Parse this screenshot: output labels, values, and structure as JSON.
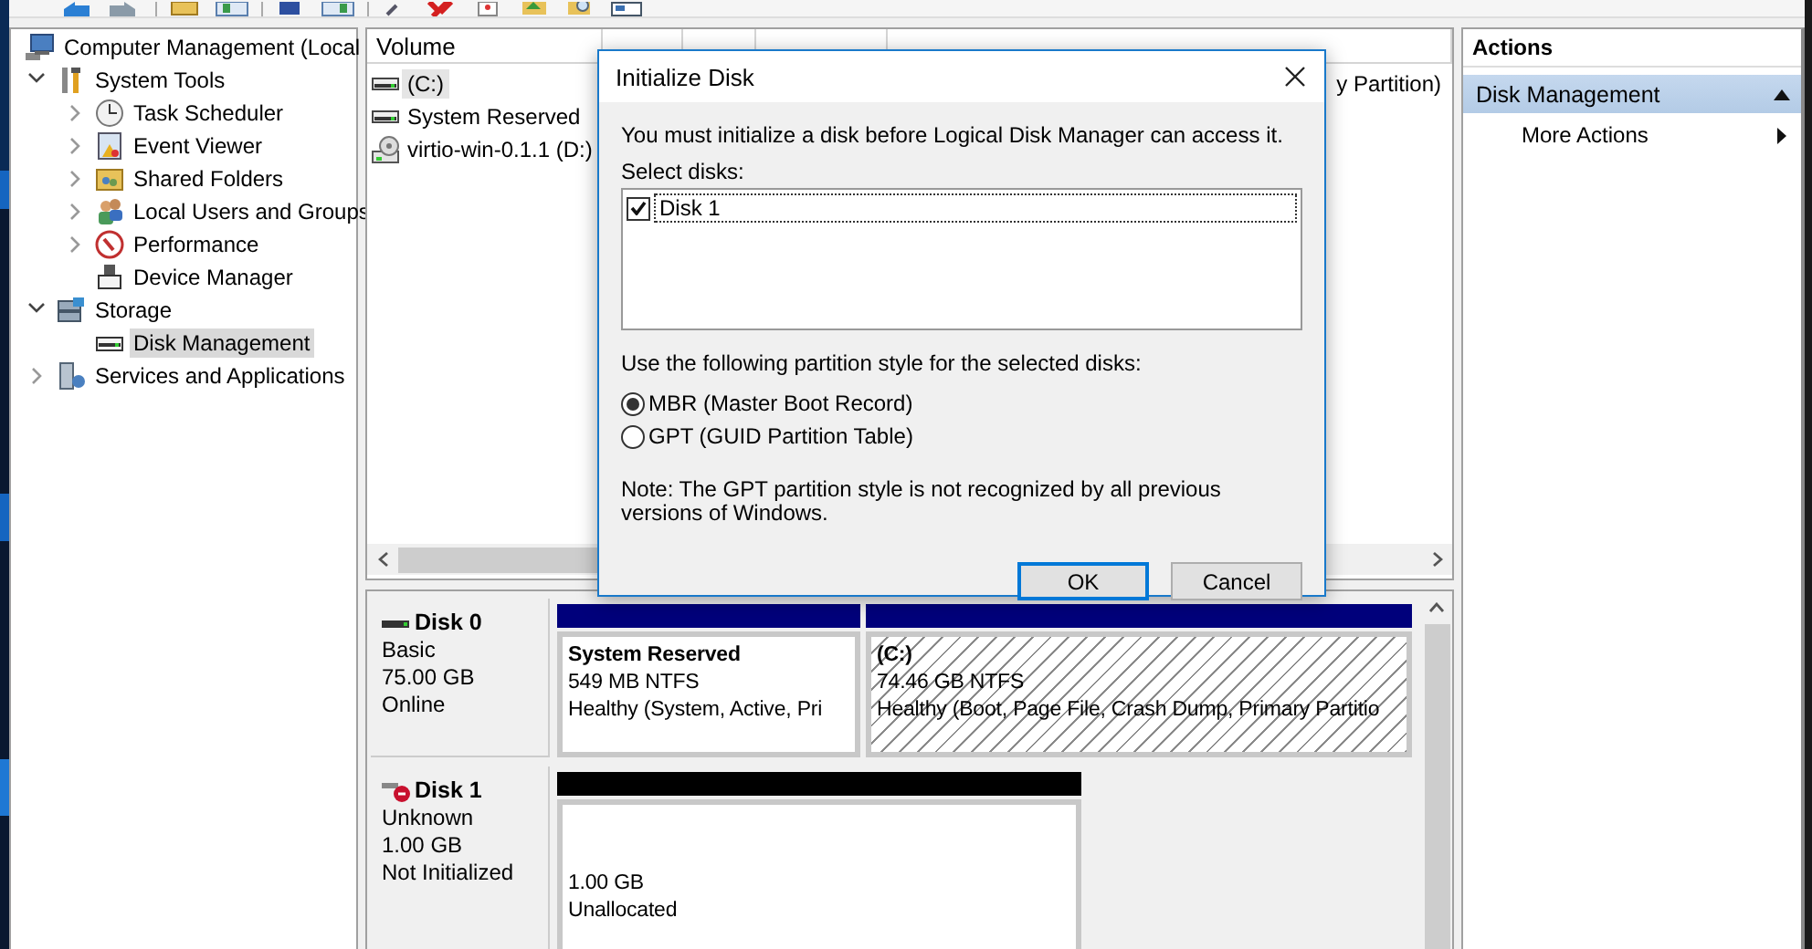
{
  "tree": {
    "items": [
      {
        "label": "Computer Management (Local",
        "selected": false,
        "children": [
          {
            "label": "System Tools",
            "expanded": true,
            "selected": false,
            "children": [
              {
                "label": "Task Scheduler",
                "expanded": false,
                "selected": false
              },
              {
                "label": "Event Viewer",
                "expanded": false,
                "selected": false
              },
              {
                "label": "Shared Folders",
                "expanded": false,
                "selected": false
              },
              {
                "label": "Local Users and Groups",
                "expanded": false,
                "selected": false
              },
              {
                "label": "Performance",
                "expanded": false,
                "selected": false
              },
              {
                "label": "Device Manager",
                "selected": false
              }
            ]
          },
          {
            "label": "Storage",
            "expanded": true,
            "selected": false,
            "children": [
              {
                "label": "Disk Management",
                "selected": true
              }
            ]
          },
          {
            "label": "Services and Applications",
            "expanded": false,
            "selected": false
          }
        ]
      }
    ]
  },
  "volume_list": {
    "columns": [
      "Volume"
    ],
    "rows": [
      {
        "volume": "(C:)",
        "kind": "drive",
        "status": "y Partition)",
        "selected": true
      },
      {
        "volume": "System Reserved",
        "kind": "drive",
        "selected": false
      },
      {
        "volume": "virtio-win-0.1.1 (D:)",
        "kind": "cd",
        "selected": false
      }
    ]
  },
  "disks": [
    {
      "name": "Disk 0",
      "kind": "online",
      "type": "Basic",
      "size": "75.00 GB",
      "state": "Online",
      "partitions": [
        {
          "name": "System Reserved",
          "size": "549 MB NTFS",
          "status": "Healthy (System, Active, Pri",
          "kind": "primary",
          "selected": false
        },
        {
          "name": "(C:)",
          "size": "74.46 GB NTFS",
          "status": "Healthy (Boot, Page File, Crash Dump, Primary Partitio",
          "kind": "primary",
          "selected": true
        }
      ]
    },
    {
      "name": "Disk 1",
      "kind": "error",
      "type": "Unknown",
      "size": "1.00 GB",
      "state": "Not Initialized",
      "partitions": [
        {
          "size": "1.00 GB",
          "status": "Unallocated",
          "kind": "unallocated",
          "selected": false
        }
      ]
    }
  ],
  "actions": {
    "title": "Actions",
    "sections": [
      {
        "label": "Disk Management",
        "expanded": true,
        "items": [
          {
            "label": "More Actions"
          }
        ]
      }
    ]
  },
  "dialog": {
    "title": "Initialize Disk",
    "message": "You must initialize a disk before Logical Disk Manager can access it.",
    "select_label": "Select disks:",
    "disks": [
      {
        "label": "Disk 1",
        "checked": true
      }
    ],
    "style_label": "Use the following partition style for the selected disks:",
    "styles": [
      {
        "label": "MBR (Master Boot Record)",
        "selected": true
      },
      {
        "label": "GPT (GUID Partition Table)",
        "selected": false
      }
    ],
    "note": "Note: The GPT partition style is not recognized by all previous versions of Windows.",
    "buttons": [
      {
        "label": "OK",
        "default": true
      },
      {
        "label": "Cancel",
        "default": false
      }
    ]
  }
}
